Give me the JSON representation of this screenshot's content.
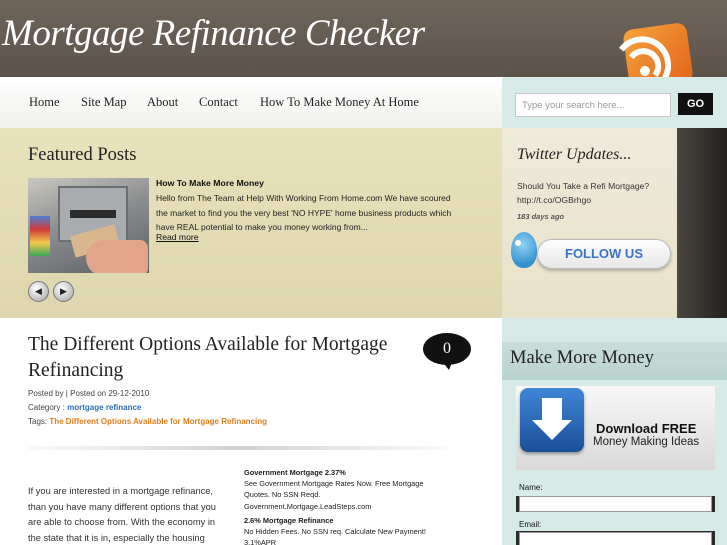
{
  "header": {
    "site_title": "Mortgage Refinance Checker"
  },
  "nav": {
    "items": [
      "Home",
      "Site Map",
      "About",
      "Contact",
      "How To Make Money At Home"
    ]
  },
  "search": {
    "placeholder": "Type your search here...",
    "button_label": "GO"
  },
  "featured": {
    "title": "Featured Posts",
    "post_title": "How To Make More Money",
    "post_excerpt": "Hello from The Team at Help With Working From Home.com We have scoured the market to find you the very best 'NO HYPE' home business products which have REAL potential to make you money working from...",
    "read_more": "Read more",
    "prev_icon": "◀",
    "next_icon": "▶"
  },
  "twitter": {
    "title": "Twitter Updates...",
    "tweet": "Should You Take a Refi Mortgage? http://t.co/OGBrhgo",
    "time": "183 days ago",
    "follow_label": "FOLLOW US"
  },
  "article": {
    "title": "The Different Options Available for Mortgage Refinancing",
    "comment_count": "0",
    "posted": "Posted by | Posted on 29-12-2010",
    "category_label": "Category :",
    "category": "mortgage refinance",
    "tags_label": "Tags:",
    "tags": "The Different Options Available for Mortgage Refinancing",
    "body": "If you are interested in a mortgage refinance, than you have many different options that you are able to choose from. With the economy in the state that it is in, especially the housing"
  },
  "ads": [
    {
      "title": "Government Mortgage 2.37%",
      "text": "See Government Mortgage Rates Now. Free Mortgage Quotes. No SSN Reqd.",
      "url": "Government.Mortgage.LeadSteps.com"
    },
    {
      "title": "2.6% Mortgage Refinance",
      "text": "No Hidden Fees. No SSN req. Calculate New Payment! 3.1%APR",
      "url": ""
    }
  ],
  "sidebar": {
    "make_money_title": "Make More Money",
    "download_free": "Download FREE",
    "money_ideas": "Money Making Ideas",
    "name_label": "Name:",
    "email_label": "Email:"
  }
}
